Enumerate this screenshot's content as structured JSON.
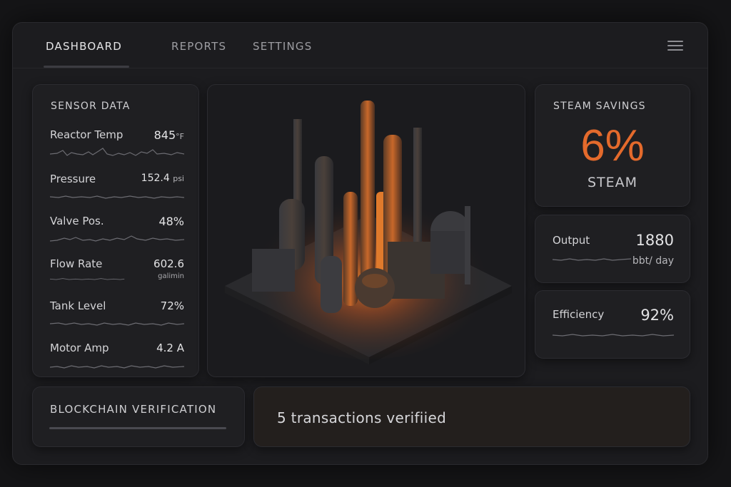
{
  "nav": {
    "tabs": [
      {
        "label": "DASHBOARD",
        "active": true
      },
      {
        "label": "REPORTS",
        "active": false
      },
      {
        "label": "SETTINGS",
        "active": false
      }
    ],
    "menu_icon": "hamburger-menu-icon"
  },
  "sensor_data": {
    "title": "SENSOR DATA",
    "items": [
      {
        "label": "Reactor Temp",
        "value": "845",
        "unit": "°F"
      },
      {
        "label": "Pressure",
        "value": "152.4",
        "unit": "psi"
      },
      {
        "label": "Valve Pos.",
        "value": "48%",
        "unit": ""
      },
      {
        "label": "Flow Rate",
        "value": "602.6",
        "unit": "galimin"
      },
      {
        "label": "Tank Level",
        "value": "72%",
        "unit": ""
      },
      {
        "label": "Motor Amp",
        "value": "4.2 A",
        "unit": ""
      }
    ]
  },
  "steam_savings": {
    "title": "STEAM SAVINGS",
    "value": "6%",
    "label": "STEAM"
  },
  "output": {
    "label": "Output",
    "value": "1880",
    "unit": "bbt/ day"
  },
  "efficiency": {
    "label": "Efficiency",
    "value": "92%"
  },
  "blockchain": {
    "title": "BLOCKCHAIN VERIFICATION"
  },
  "transactions": {
    "text": "5  transactions verifiied"
  },
  "colors": {
    "accent": "#e46a2c",
    "background": "#151517",
    "card": "#1f1f22"
  }
}
